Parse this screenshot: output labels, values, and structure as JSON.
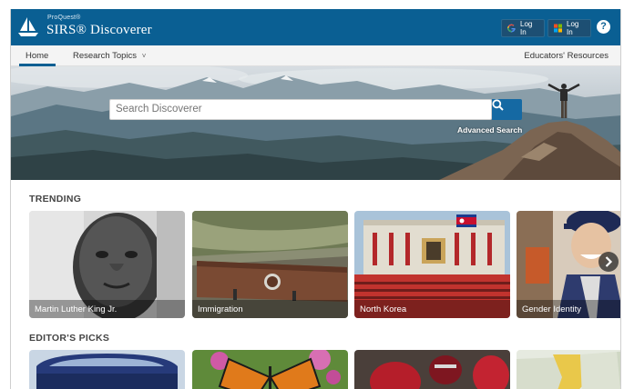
{
  "header": {
    "brand_small": "ProQuest®",
    "brand_big": "SIRS® Discoverer",
    "login_google": "Log In",
    "login_microsoft": "Log In",
    "help_symbol": "?"
  },
  "nav": {
    "home": "Home",
    "research_topics": "Research Topics",
    "research_topics_caret": "˅",
    "educators": "Educators' Resources"
  },
  "search": {
    "placeholder": "Search Discoverer",
    "advanced_link": "Advanced Search"
  },
  "trending": {
    "title": "TRENDING",
    "cards": [
      {
        "label": "Martin Luther King Jr."
      },
      {
        "label": "Immigration"
      },
      {
        "label": "North Korea"
      },
      {
        "label": "Gender Identity"
      }
    ]
  },
  "editors_picks": {
    "title": "EDITOR'S PICKS"
  },
  "colors": {
    "brand_blue": "#0a5f93",
    "search_button": "#1569a3",
    "nav_bg": "#f4f4f4"
  },
  "icons": {
    "logo": "sailboat-icon",
    "google": "google-g-icon",
    "microsoft": "microsoft-icon",
    "help": "question-icon",
    "search": "magnifier-icon",
    "next": "chevron-right-icon"
  }
}
